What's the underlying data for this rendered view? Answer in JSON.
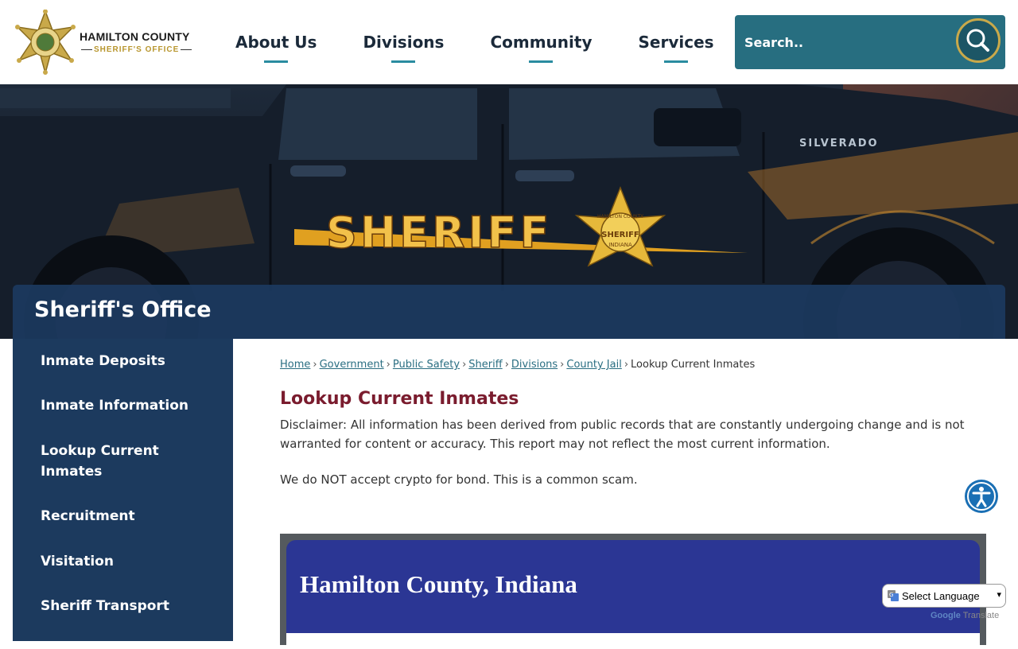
{
  "logo": {
    "line1": "HAMILTON COUNTY",
    "line2": "SHERIFF'S OFFICE"
  },
  "nav": [
    {
      "label": "About Us"
    },
    {
      "label": "Divisions"
    },
    {
      "label": "Community"
    },
    {
      "label": "Services"
    }
  ],
  "search": {
    "placeholder": "Search.."
  },
  "hero": {
    "decal_text": "SHERIFF",
    "badge_top": "HAMILTON COUNTY",
    "badge_mid": "SHERIFF",
    "badge_bottom": "INDIANA",
    "truck_model": "SILVERADO"
  },
  "section": {
    "title": "Sheriff's Office"
  },
  "sidebar": {
    "items": [
      {
        "label": "Inmate Deposits"
      },
      {
        "label": "Inmate Information"
      },
      {
        "label": "Lookup Current Inmates"
      },
      {
        "label": "Recruitment"
      },
      {
        "label": "Visitation"
      },
      {
        "label": "Sheriff Transport"
      }
    ]
  },
  "breadcrumb": {
    "links": [
      "Home",
      "Government",
      "Public Safety",
      "Sheriff",
      "Divisions",
      "County Jail"
    ],
    "current": "Lookup Current Inmates",
    "separator": "›"
  },
  "main": {
    "title": "Lookup Current Inmates",
    "disclaimer": "Disclaimer: All information has been derived from public records that are constantly undergoing change and is not warranted for content or accuracy. This report may not reflect the most current information.",
    "crypto_notice": "We do NOT accept crypto for bond.  This is a common scam.",
    "embed_title": "Hamilton County, Indiana"
  },
  "translate": {
    "select_label": "Select Language",
    "powered_google": "Google",
    "powered_translate": "Translate"
  },
  "colors": {
    "nav_accent": "#2a8ca0",
    "sidebar_bg": "#1c3a5e",
    "title_red": "#7a1c2e",
    "search_bg": "#276e80",
    "embed_blue": "#2b3694"
  }
}
